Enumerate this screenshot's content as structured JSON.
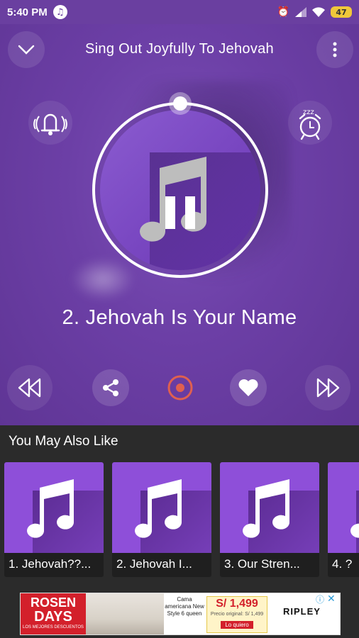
{
  "status_bar": {
    "time": "5:40 PM",
    "battery": "47"
  },
  "header": {
    "title": "Sing Out Joyfully To Jehovah"
  },
  "player": {
    "song_title": "2. Jehovah Is Your Name",
    "state": "playing",
    "accent_color": "#6c3fa6",
    "record_color": "#e0604f"
  },
  "recommend": {
    "title": "You May Also Like",
    "items": [
      {
        "label": "1. Jehovah??..."
      },
      {
        "label": "2. Jehovah I..."
      },
      {
        "label": "3. Our Stren..."
      },
      {
        "label": "4. ?"
      }
    ]
  },
  "ad": {
    "brand_line1": "ROSEN",
    "brand_line2": "DAYS",
    "brand_line3": "LOS MEJORES DESCUENTOS",
    "promo": "Cama americana New Style 6 queen",
    "price": "S/ 1,499",
    "price_note": "Precio original: S/ 1,499",
    "cta": "Lo quiero",
    "retailer": "RIPLEY"
  }
}
